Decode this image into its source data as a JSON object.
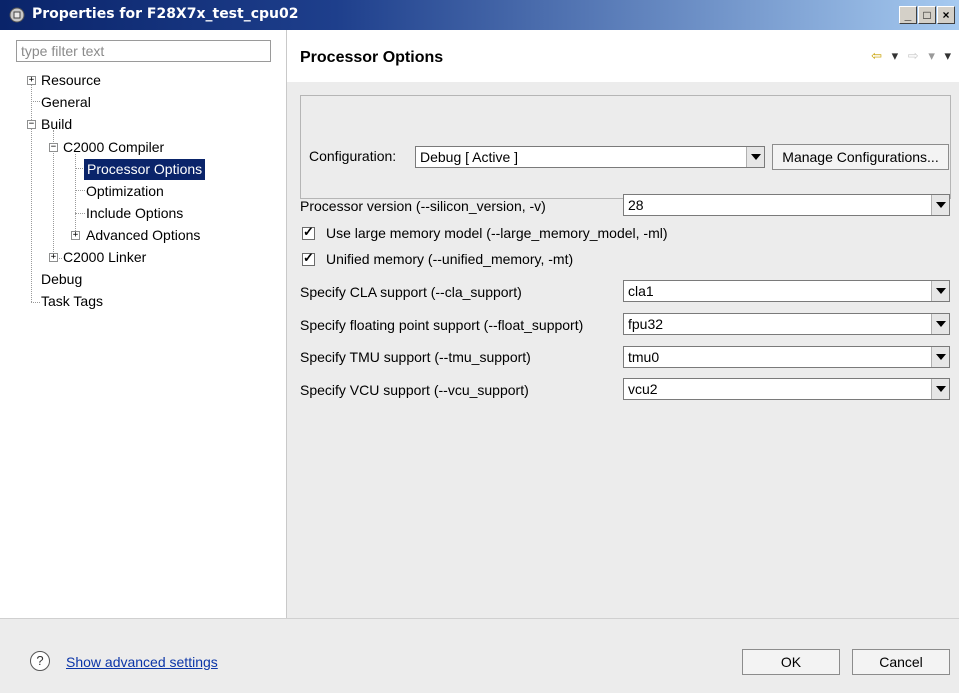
{
  "window": {
    "title": "Properties for F28X7x_test_cpu02",
    "minimize_glyph": "_",
    "maximize_glyph": "□",
    "close_glyph": "×"
  },
  "sidebar": {
    "filter_placeholder": "type filter text",
    "items": [
      {
        "label": "Resource"
      },
      {
        "label": "General"
      },
      {
        "label": "Build"
      },
      {
        "label": "C2000 Compiler"
      },
      {
        "label": "Processor Options"
      },
      {
        "label": "Optimization"
      },
      {
        "label": "Include Options"
      },
      {
        "label": "Advanced Options"
      },
      {
        "label": "C2000 Linker"
      },
      {
        "label": "Debug"
      },
      {
        "label": "Task Tags"
      }
    ],
    "selected": "Processor Options"
  },
  "page": {
    "title": "Processor Options",
    "nav": {
      "back": "⇦",
      "dropdown": "▾",
      "forward": "⇨"
    }
  },
  "configuration": {
    "label": "Configuration:",
    "value": "Debug  [ Active ]",
    "manage_button": "Manage Configurations..."
  },
  "options": {
    "processor_version_label": "Processor version (--silicon_version, -v)",
    "processor_version_value": "28",
    "large_memory_label": "Use large memory model (--large_memory_model, -ml)",
    "large_memory_checked": true,
    "unified_memory_label": "Unified memory (--unified_memory, -mt)",
    "unified_memory_checked": true,
    "cla_label": "Specify CLA support (--cla_support)",
    "cla_value": "cla1",
    "float_label": "Specify floating point support (--float_support)",
    "float_value": "fpu32",
    "tmu_label": "Specify TMU support (--tmu_support)",
    "tmu_value": "tmu0",
    "vcu_label": "Specify VCU support (--vcu_support)",
    "vcu_value": "vcu2"
  },
  "footer": {
    "help_glyph": "?",
    "advanced_link": "Show advanced settings",
    "ok_button": "OK",
    "cancel_button": "Cancel"
  }
}
